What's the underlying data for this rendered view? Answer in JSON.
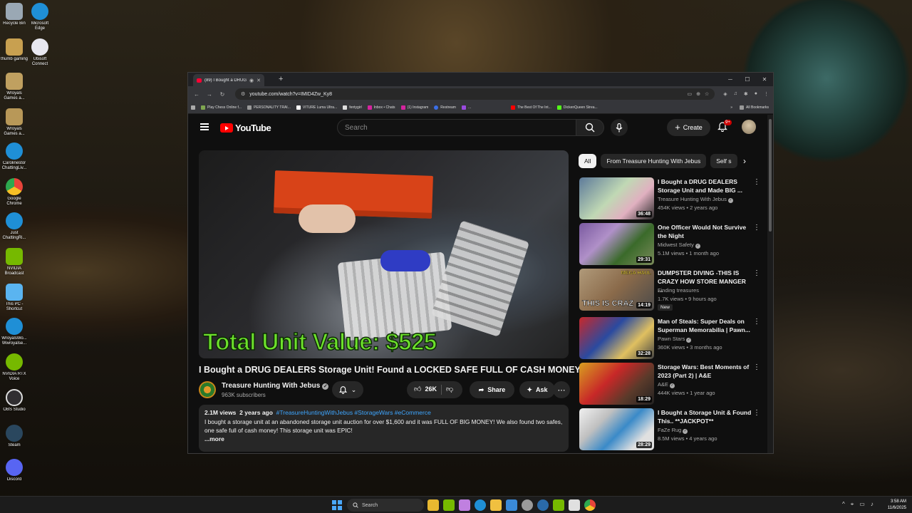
{
  "desktop": {
    "icons": [
      {
        "label": "Recycle Bin",
        "icon": "recycle-bin-icon",
        "color": "#9aa8b4"
      },
      {
        "label": "Microsoft Edge",
        "icon": "edge-icon",
        "color": "#1f8fd6"
      },
      {
        "label": "thumb gaming",
        "icon": "image-file-icon",
        "color": "#c8a050"
      },
      {
        "label": "Ubisoft Connect",
        "icon": "ubisoft-icon",
        "color": "#e8e8f0"
      },
      {
        "label": "Wroyals Games a...",
        "icon": "image-file-icon",
        "color": "#c0a060"
      },
      {
        "label": "Wroyals Games a...",
        "icon": "image-file-icon",
        "color": "#b89858"
      },
      {
        "label": "Carolinestor ChattingLiv...",
        "icon": "edge-icon",
        "color": "#1f8fd6"
      },
      {
        "label": "Google Chrome",
        "icon": "chrome-icon",
        "color": "#e8443a"
      },
      {
        "label": "Just ChattingRi...",
        "icon": "edge-icon",
        "color": "#1f8fd6"
      },
      {
        "label": "NVIDIA Broadcast",
        "icon": "nvidia-icon",
        "color": "#76b900"
      },
      {
        "label": "This PC - Shortcut",
        "icon": "monitor-icon",
        "color": "#5ab4f0"
      },
      {
        "label": "WroyalsWo... Wwroyalse...",
        "icon": "edge-icon",
        "color": "#1f8fd6"
      },
      {
        "label": "NVIDIA RTX Voice",
        "icon": "headset-icon",
        "color": "#76b900"
      },
      {
        "label": "OBS Studio",
        "icon": "obs-icon",
        "color": "#302e31"
      },
      {
        "label": "Steam",
        "icon": "steam-icon",
        "color": "#2a475e"
      },
      {
        "label": "Discord",
        "icon": "discord-icon",
        "color": "#5865f2"
      }
    ]
  },
  "browser": {
    "tab_title": "(89) I Bought a DRUG DEAL",
    "url": "youtube.com/watch?v=IMID4Zw_Ky8",
    "bookmarks": [
      "Play Chess Online f...",
      "PERSONALITY TRAI...",
      "VITURE Luma Ultra...",
      "fentygirl",
      "Inbox • Chats",
      "(1) Instagram",
      "Restream",
      "...",
      "The Best Of The Int...",
      "DickenQueen Strea..."
    ],
    "all_bookmarks": "All Bookmarks"
  },
  "youtube": {
    "logo_text": "YouTube",
    "search_placeholder": "Search",
    "create_label": "Create",
    "notif_count": "9+",
    "video_overlay": "Total Unit Value: $525",
    "title": "I Bought a DRUG DEALERS Storage Unit! Found a LOCKED SAFE FULL OF CASH MONEY!",
    "channel": "Treasure Hunting With Jebus",
    "subscribers": "963K subscribers",
    "likes": "26K",
    "share_label": "Share",
    "ask_label": "Ask",
    "views": "2.1M views",
    "age": "2 years ago",
    "tags": "#TreasureHuntingWithJebus #StorageWars #eCommerce",
    "description": "I bought a storage unit at an abandoned storage unit auction for over $1,600 and it was FULL OF BIG MONEY! We also found two safes, one safe full of cash money! This storage unit was EPIC!",
    "more_label": "...more",
    "chips": [
      "All",
      "From Treasure Hunting With Jebus",
      "Self s"
    ],
    "recommendations": [
      {
        "title": "I Bought a DRUG DEALERS Storage Unit and Made BIG ...",
        "channel": "Treasure Hunting With Jebus",
        "meta": "454K views • 2 years ago",
        "duration": "36:48",
        "badge": ""
      },
      {
        "title": "One Officer Would Not Survive the Night",
        "channel": "Midwest Safety",
        "meta": "5.1M views • 1 month ago",
        "duration": "29:31",
        "badge": ""
      },
      {
        "title": "DUMPSTER DIVING -THIS IS CRAZY HOW STORE MANGER ...",
        "channel": "Finding treasures",
        "meta": "1.7K views • 9 hours ago",
        "duration": "14:19",
        "badge": "New",
        "thumb_text": "THIS IS CRAZ",
        "thumb_tag": "MEGA HAUL"
      },
      {
        "title": "Man of Steals: Super Deals on Superman Memorabilia | Pawn...",
        "channel": "Pawn Stars",
        "meta": "360K views • 3 months ago",
        "duration": "32:28",
        "badge": ""
      },
      {
        "title": "Storage Wars: Best Moments of 2023 (Part 2) | A&E",
        "channel": "A&E",
        "meta": "444K views • 1 year ago",
        "duration": "18:29",
        "badge": ""
      },
      {
        "title": "I Bought a Storage Unit & Found This.. **JACKPOT**",
        "channel": "FaZe Rug",
        "meta": "8.5M views • 4 years ago",
        "duration": "28:29",
        "badge": ""
      }
    ]
  },
  "taskbar": {
    "search_label": "Search",
    "time": "3:58 AM",
    "date": "11/6/2025",
    "apps": [
      {
        "icon": "file-explorer-icon",
        "color": "#e8b830"
      },
      {
        "icon": "headset-icon",
        "color": "#76b900"
      },
      {
        "icon": "copilot-icon",
        "color": "#c080e0"
      },
      {
        "icon": "edge-icon",
        "color": "#1f8fd6"
      },
      {
        "icon": "folder-icon",
        "color": "#f0c040"
      },
      {
        "icon": "store-icon",
        "color": "#3a8ad8"
      },
      {
        "icon": "settings-icon",
        "color": "#9a9a9a"
      },
      {
        "icon": "steam-icon",
        "color": "#2a6aa8"
      },
      {
        "icon": "nvidia-icon",
        "color": "#76b900"
      },
      {
        "icon": "capcut-icon",
        "color": "#e0e0e0"
      },
      {
        "icon": "chrome-icon",
        "color": "#e8443a"
      }
    ]
  }
}
